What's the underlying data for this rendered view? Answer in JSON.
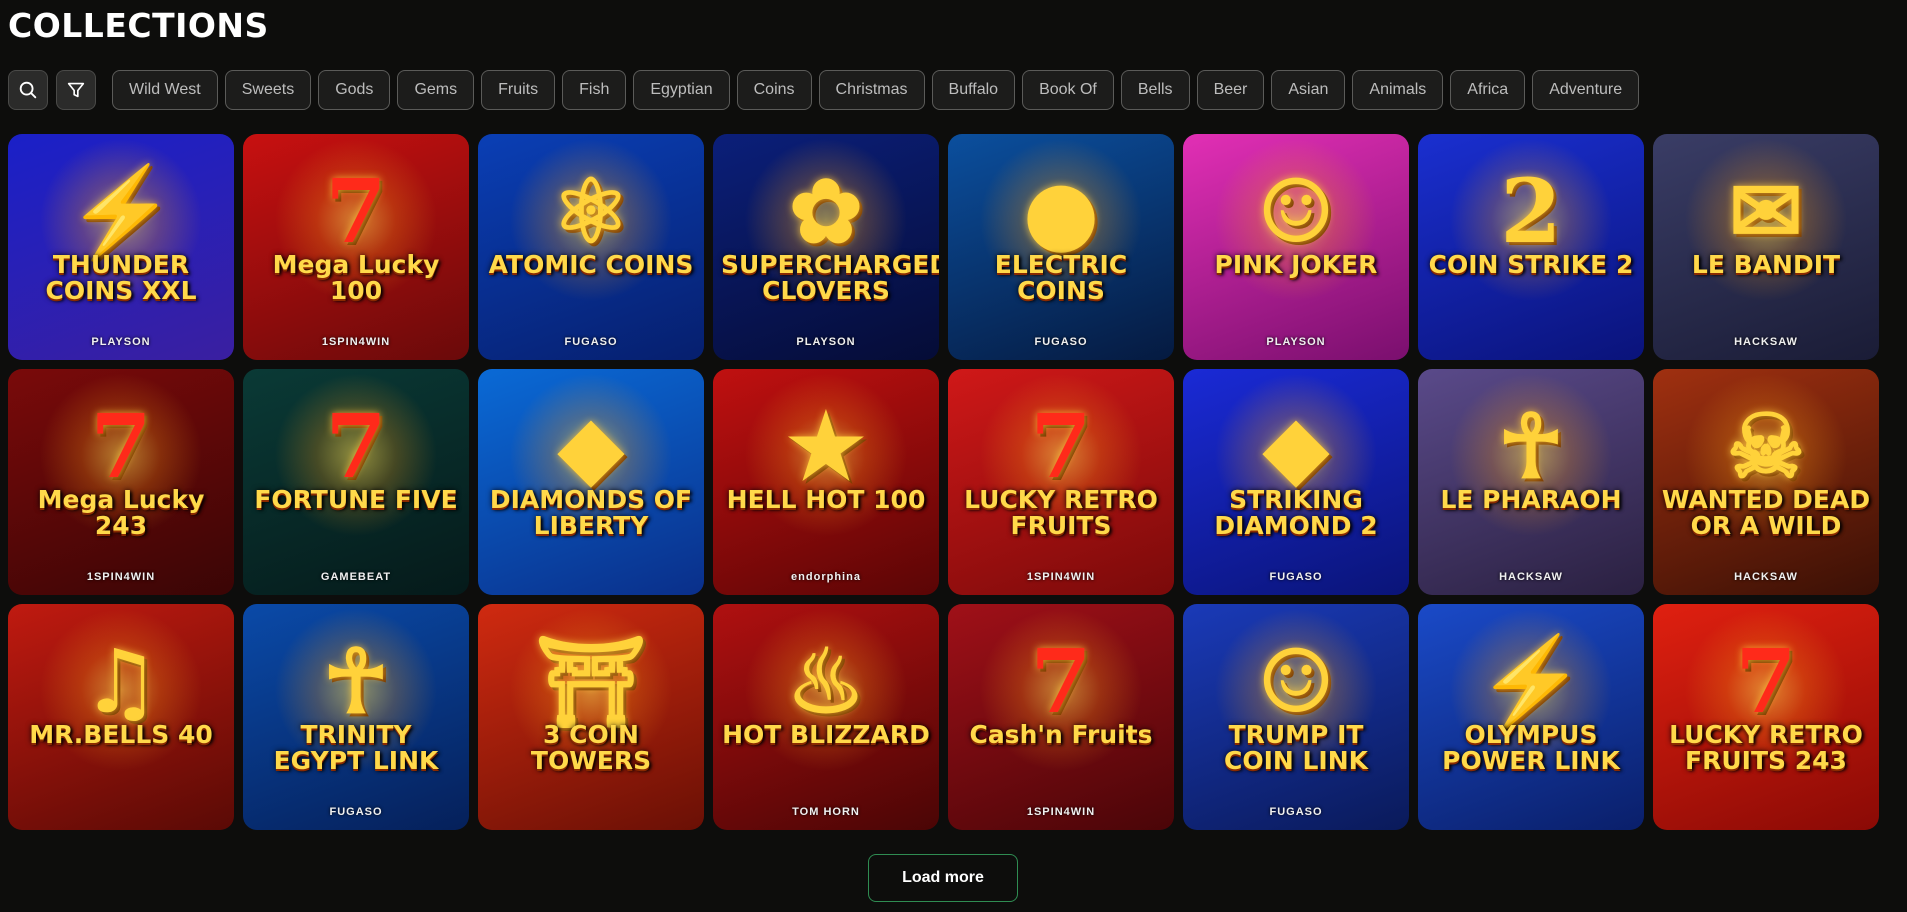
{
  "page": {
    "title": "COLLECTIONS"
  },
  "filters": [
    "Wild West",
    "Sweets",
    "Gods",
    "Gems",
    "Fruits",
    "Fish",
    "Egyptian",
    "Coins",
    "Christmas",
    "Buffalo",
    "Book Of",
    "Bells",
    "Beer",
    "Asian",
    "Animals",
    "Africa",
    "Adventure"
  ],
  "games": [
    {
      "title": "THUNDER COINS XXL",
      "provider": "PLAYSON",
      "art": "⚡",
      "bg": [
        "#1a20c8",
        "#3a1fa0"
      ]
    },
    {
      "title": "Mega Lucky 100",
      "provider": "1SPIN4WIN",
      "art": "7",
      "bg": [
        "#c81010",
        "#6a0a0a"
      ]
    },
    {
      "title": "ATOMIC COINS",
      "provider": "FUGASO",
      "art": "⚛",
      "bg": [
        "#0a3fb5",
        "#061f6e"
      ]
    },
    {
      "title": "SUPERCHARGED CLOVERS",
      "provider": "PLAYSON",
      "art": "✿",
      "bg": [
        "#0b1f7a",
        "#050c36"
      ]
    },
    {
      "title": "ELECTRIC COINS",
      "provider": "FUGASO",
      "art": "●",
      "bg": [
        "#0b4f9e",
        "#051a40"
      ]
    },
    {
      "title": "PINK JOKER",
      "provider": "PLAYSON",
      "art": "☺",
      "bg": [
        "#e22fb5",
        "#7a0f6e"
      ]
    },
    {
      "title": "COIN STRIKE 2",
      "provider": "",
      "art": "2",
      "bg": [
        "#1a2fd0",
        "#0a137a"
      ]
    },
    {
      "title": "LE BANDIT",
      "provider": "HACKSAW",
      "art": "✉",
      "bg": [
        "#3a3d66",
        "#1a1c36"
      ]
    },
    {
      "title": "Mega Lucky 243",
      "provider": "1SPIN4WIN",
      "art": "7",
      "bg": [
        "#7a0a0a",
        "#3a0505"
      ]
    },
    {
      "title": "FORTUNE FIVE",
      "provider": "GAMEBEAT",
      "art": "7",
      "bg": [
        "#0a3a36",
        "#051a1a"
      ]
    },
    {
      "title": "DIAMONDS OF LIBERTY",
      "provider": "",
      "art": "◆",
      "bg": [
        "#0a6ad6",
        "#0a2f8a"
      ]
    },
    {
      "title": "HELL HOT 100",
      "provider": "endorphina",
      "art": "★",
      "bg": [
        "#c01010",
        "#5a0505"
      ]
    },
    {
      "title": "LUCKY RETRO FRUITS",
      "provider": "1SPIN4WIN",
      "art": "7",
      "bg": [
        "#d01818",
        "#7a0a0a"
      ]
    },
    {
      "title": "STRIKING DIAMOND 2",
      "provider": "FUGASO",
      "art": "◆",
      "bg": [
        "#1a2ad6",
        "#0a1478"
      ]
    },
    {
      "title": "LE PHARAOH",
      "provider": "HACKSAW",
      "art": "☥",
      "bg": [
        "#5a4a8a",
        "#2a2040"
      ]
    },
    {
      "title": "WANTED DEAD OR A WILD",
      "provider": "HACKSAW",
      "art": "☠",
      "bg": [
        "#a03010",
        "#3a1005"
      ]
    },
    {
      "title": "MR.BELLS 40",
      "provider": "",
      "art": "♫",
      "bg": [
        "#c01a10",
        "#5a0a05"
      ]
    },
    {
      "title": "TRINITY EGYPT LINK",
      "provider": "FUGASO",
      "art": "☥",
      "bg": [
        "#0a4aa8",
        "#05205a"
      ]
    },
    {
      "title": "3 COIN TOWERS",
      "provider": "",
      "art": "⛩",
      "bg": [
        "#d02a10",
        "#6a1005"
      ]
    },
    {
      "title": "HOT BLIZZARD",
      "provider": "TOM HORN",
      "art": "♨",
      "bg": [
        "#b01010",
        "#4a0505"
      ]
    },
    {
      "title": "Cash'n Fruits",
      "provider": "1SPIN4WIN",
      "art": "7",
      "bg": [
        "#a01018",
        "#4a0508"
      ]
    },
    {
      "title": "TRUMP IT COIN LINK",
      "provider": "FUGASO",
      "art": "☺",
      "bg": [
        "#1a3ab8",
        "#0a1a5a"
      ]
    },
    {
      "title": "OLYMPUS POWER LINK",
      "provider": "",
      "art": "⚡",
      "bg": [
        "#1a4ac8",
        "#0a1f6a"
      ]
    },
    {
      "title": "LUCKY RETRO FRUITS 243",
      "provider": "",
      "art": "7",
      "bg": [
        "#e02010",
        "#8a0a05"
      ]
    }
  ],
  "load_more": {
    "label": "Load more"
  },
  "colors": {
    "background": "#0d0d0c",
    "accent": "#2f8c52",
    "chip_border": "#5b5b59"
  },
  "icons": {
    "search": "search-icon",
    "filter": "filter-icon"
  }
}
